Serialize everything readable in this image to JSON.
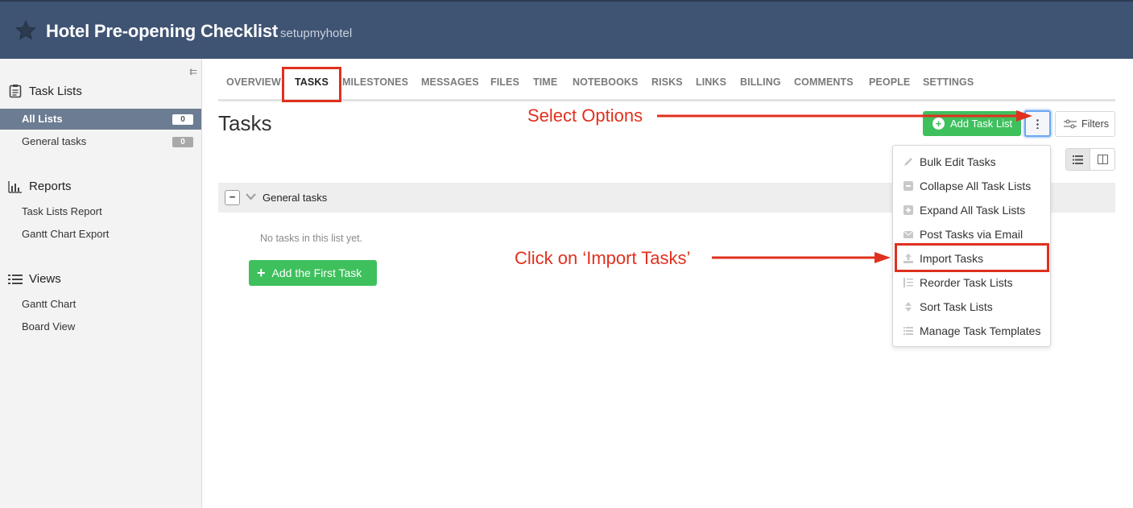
{
  "header": {
    "title": "Hotel Pre-opening Checklist",
    "company": "setupmyhotel",
    "background": "#3f5373"
  },
  "sidebar": {
    "task_lists_heading": "Task Lists",
    "lists": [
      {
        "label": "All Lists",
        "count": "0",
        "active": true
      },
      {
        "label": "General tasks",
        "count": "0",
        "active": false
      }
    ],
    "reports_heading": "Reports",
    "reports": [
      "Task Lists Report",
      "Gantt Chart Export"
    ],
    "views_heading": "Views",
    "views": [
      "Gantt Chart",
      "Board View"
    ]
  },
  "tabs": [
    "OVERVIEW",
    "TASKS",
    "MILESTONES",
    "MESSAGES",
    "FILES",
    "TIME",
    "NOTEBOOKS",
    "RISKS",
    "LINKS",
    "BILLING",
    "COMMENTS",
    "PEOPLE",
    "SETTINGS"
  ],
  "active_tab": "TASKS",
  "page": {
    "title": "Tasks",
    "add_task_list": "Add Task List",
    "filters": "Filters"
  },
  "task_list": {
    "name": "General tasks",
    "empty_text": "No tasks in this list yet.",
    "add_first": "Add the First Task"
  },
  "options_menu": [
    {
      "label": "Bulk Edit Tasks",
      "icon": "pencil-icon"
    },
    {
      "label": "Collapse All Task Lists",
      "icon": "minus-square-icon"
    },
    {
      "label": "Expand All Task Lists",
      "icon": "plus-square-icon"
    },
    {
      "label": "Post Tasks via Email",
      "icon": "envelope-icon"
    },
    {
      "label": "Import Tasks",
      "icon": "upload-icon"
    },
    {
      "label": "Reorder Task Lists",
      "icon": "reorder-icon"
    },
    {
      "label": "Sort Task Lists",
      "icon": "sort-icon"
    },
    {
      "label": "Manage Task Templates",
      "icon": "list-icon"
    }
  ],
  "annotations": {
    "select_options": "Select Options",
    "click_import": "Click on ‘Import Tasks’",
    "color": "#e0301e"
  },
  "colors": {
    "green": "#3ec05d",
    "sidebar_active": "#6c7c92"
  }
}
